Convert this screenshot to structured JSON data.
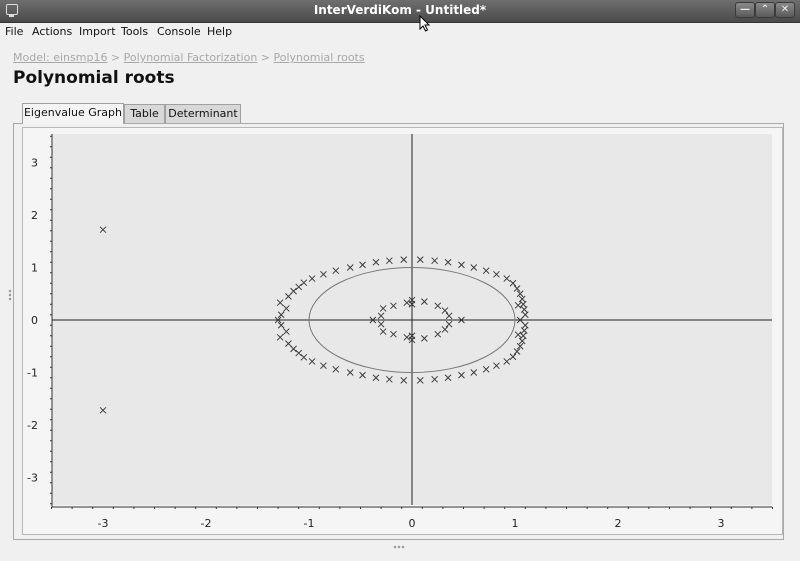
{
  "window": {
    "title": "InterVerdiKom - Untitled*",
    "icon": "app-icon",
    "controls": [
      "minimize",
      "maximize",
      "close"
    ]
  },
  "menu": [
    "File",
    "Actions",
    "Import",
    "Tools",
    "Console",
    "Help"
  ],
  "breadcrumb": {
    "items": [
      "Model: einsmp16",
      "Polynomial Factorization",
      "Polynomial roots"
    ],
    "separator": ">"
  },
  "page_title": "Polynomial roots",
  "tabs": [
    {
      "label": "Eigenvalue Graph",
      "active": true
    },
    {
      "label": "Table",
      "active": false
    },
    {
      "label": "Determinant",
      "active": false
    }
  ],
  "chart_data": {
    "type": "scatter",
    "title": "",
    "xlabel": "",
    "ylabel": "",
    "xlim": [
      -3.5,
      3.5
    ],
    "ylim": [
      -3.5,
      3.5
    ],
    "xticks": [
      "-3",
      "-2",
      "-1",
      "0",
      "1",
      "2",
      "3"
    ],
    "yticks": [
      "3",
      "2",
      "1",
      "0",
      "-1",
      "-2",
      "-3"
    ],
    "grid": false,
    "marker": "x",
    "unit_circle": true,
    "colors": {
      "background": "#e8e8e8",
      "marker": "#333333",
      "axis": "#222222",
      "circle": "#777777"
    },
    "series": [
      {
        "points": [
          [
            -3.0,
            1.72
          ],
          [
            -3.0,
            -1.72
          ],
          [
            -1.3,
            0.0
          ],
          [
            -1.28,
            0.33
          ],
          [
            -1.28,
            -0.33
          ],
          [
            -1.27,
            0.1
          ],
          [
            -1.27,
            -0.1
          ],
          [
            -1.22,
            0.22
          ],
          [
            -1.22,
            -0.22
          ],
          [
            -1.2,
            0.45
          ],
          [
            -1.2,
            -0.45
          ],
          [
            -1.15,
            0.55
          ],
          [
            -1.15,
            -0.55
          ],
          [
            -1.1,
            0.63
          ],
          [
            -1.1,
            -0.63
          ],
          [
            -1.05,
            0.71
          ],
          [
            -1.05,
            -0.71
          ],
          [
            -0.97,
            0.79
          ],
          [
            -0.97,
            -0.79
          ],
          [
            -0.86,
            0.87
          ],
          [
            -0.86,
            -0.87
          ],
          [
            -0.74,
            0.94
          ],
          [
            -0.74,
            -0.94
          ],
          [
            -0.6,
            1.0
          ],
          [
            -0.6,
            -1.0
          ],
          [
            -0.48,
            1.05
          ],
          [
            -0.48,
            -1.05
          ],
          [
            -0.35,
            1.1
          ],
          [
            -0.35,
            -1.1
          ],
          [
            -0.22,
            1.13
          ],
          [
            -0.22,
            -1.13
          ],
          [
            -0.08,
            1.15
          ],
          [
            -0.08,
            -1.15
          ],
          [
            0.08,
            1.15
          ],
          [
            0.08,
            -1.15
          ],
          [
            0.22,
            1.13
          ],
          [
            0.22,
            -1.13
          ],
          [
            0.35,
            1.1
          ],
          [
            0.35,
            -1.1
          ],
          [
            0.48,
            1.05
          ],
          [
            0.48,
            -1.05
          ],
          [
            0.6,
            1.0
          ],
          [
            0.6,
            -1.0
          ],
          [
            0.72,
            0.94
          ],
          [
            0.72,
            -0.94
          ],
          [
            0.82,
            0.87
          ],
          [
            0.82,
            -0.87
          ],
          [
            0.92,
            0.79
          ],
          [
            0.92,
            -0.79
          ],
          [
            0.98,
            0.7
          ],
          [
            0.98,
            -0.7
          ],
          [
            1.02,
            0.6
          ],
          [
            1.02,
            -0.6
          ],
          [
            1.05,
            0.5
          ],
          [
            1.05,
            -0.5
          ],
          [
            1.07,
            0.4
          ],
          [
            1.07,
            -0.4
          ],
          [
            1.08,
            0.3
          ],
          [
            1.08,
            -0.3
          ],
          [
            1.09,
            0.2
          ],
          [
            1.09,
            -0.2
          ],
          [
            1.1,
            0.1
          ],
          [
            1.1,
            -0.1
          ],
          [
            1.05,
            0.0
          ],
          [
            1.03,
            0.28
          ],
          [
            1.03,
            -0.28
          ],
          [
            -0.38,
            0.0
          ],
          [
            -0.3,
            0.08
          ],
          [
            -0.3,
            -0.08
          ],
          [
            -0.28,
            0.22
          ],
          [
            -0.28,
            -0.22
          ],
          [
            -0.18,
            0.27
          ],
          [
            -0.18,
            -0.27
          ],
          [
            -0.05,
            0.33
          ],
          [
            -0.05,
            -0.33
          ],
          [
            0.0,
            0.38
          ],
          [
            0.0,
            -0.38
          ],
          [
            0.12,
            0.35
          ],
          [
            0.12,
            -0.35
          ],
          [
            0.25,
            0.27
          ],
          [
            0.25,
            -0.27
          ],
          [
            0.32,
            0.18
          ],
          [
            0.32,
            -0.18
          ],
          [
            0.36,
            0.08
          ],
          [
            0.36,
            -0.08
          ],
          [
            0.48,
            0.0
          ],
          [
            0.0,
            0.3
          ],
          [
            0.0,
            -0.3
          ]
        ]
      }
    ]
  }
}
